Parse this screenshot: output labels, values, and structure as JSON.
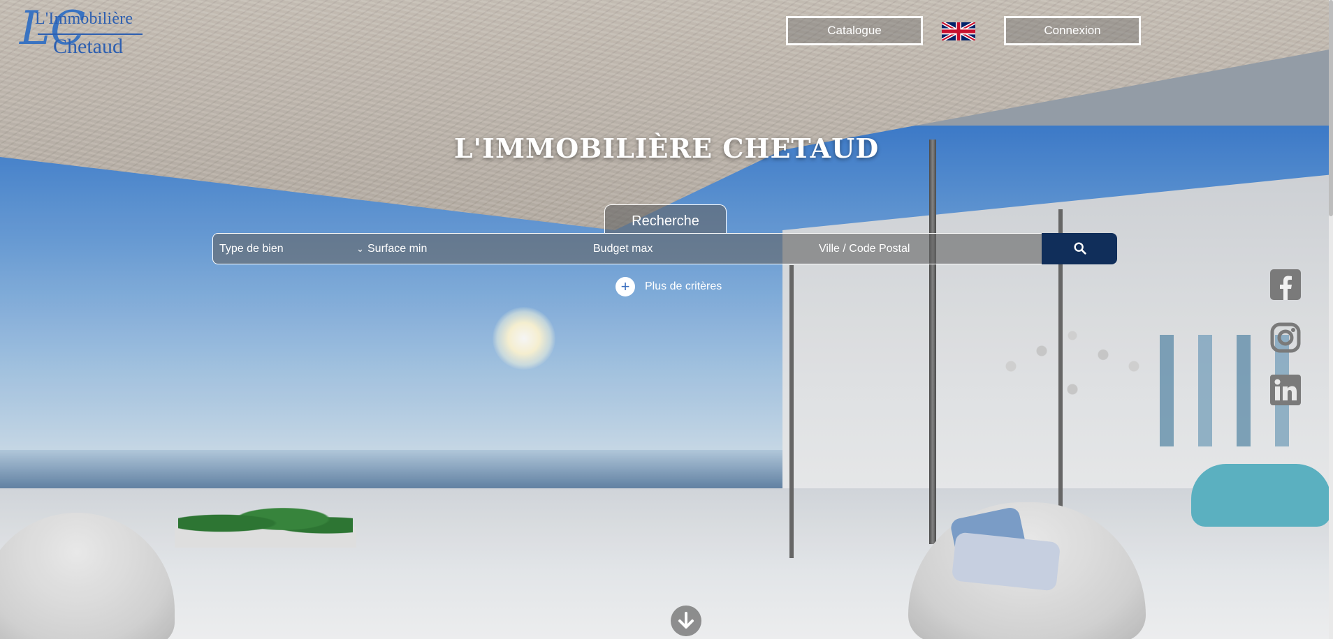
{
  "logo": {
    "line1": "L'Immobilière",
    "line2": "Chetaud",
    "monogram": "LC",
    "color": "#2d5fb0"
  },
  "nav": {
    "catalogue_label": "Catalogue",
    "connexion_label": "Connexion",
    "language_flag": "uk-flag-icon"
  },
  "hero": {
    "title": "L'IMMOBILIÈRE CHETAUD"
  },
  "search": {
    "tab_label": "Recherche",
    "type_label": "Type de bien",
    "surface_label": "Surface min",
    "budget_label": "Budget max",
    "ville_label": "Ville / Code Postal",
    "button_icon": "search-icon",
    "button_color": "#102e5a",
    "more_label": "Plus de critères"
  },
  "social": [
    "facebook-icon",
    "instagram-icon",
    "linkedin-icon"
  ],
  "scroll_down_icon": "arrow-down-icon"
}
